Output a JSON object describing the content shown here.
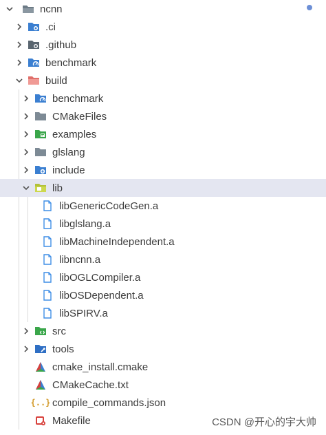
{
  "explorer": {
    "root": "ncnn",
    "items": [
      {
        "label": ".ci",
        "icon": "folder-ci-icon"
      },
      {
        "label": ".github",
        "icon": "folder-github-icon"
      },
      {
        "label": "benchmark",
        "icon": "folder-benchmark-icon"
      },
      {
        "label": "build",
        "icon": "folder-build-open-icon"
      },
      {
        "label": "benchmark",
        "icon": "folder-benchmark-icon"
      },
      {
        "label": "CMakeFiles",
        "icon": "folder-icon"
      },
      {
        "label": "examples",
        "icon": "folder-examples-icon"
      },
      {
        "label": "glslang",
        "icon": "folder-icon"
      },
      {
        "label": "include",
        "icon": "folder-include-icon"
      },
      {
        "label": "lib",
        "icon": "folder-lib-open-icon"
      },
      {
        "label": "libGenericCodeGen.a",
        "icon": "file-icon"
      },
      {
        "label": "libglslang.a",
        "icon": "file-icon"
      },
      {
        "label": "libMachineIndependent.a",
        "icon": "file-icon"
      },
      {
        "label": "libncnn.a",
        "icon": "file-icon"
      },
      {
        "label": "libOGLCompiler.a",
        "icon": "file-icon"
      },
      {
        "label": "libOSDependent.a",
        "icon": "file-icon"
      },
      {
        "label": "libSPIRV.a",
        "icon": "file-icon"
      },
      {
        "label": "src",
        "icon": "folder-src-icon"
      },
      {
        "label": "tools",
        "icon": "folder-tools-icon"
      },
      {
        "label": "cmake_install.cmake",
        "icon": "cmake-icon"
      },
      {
        "label": "CMakeCache.txt",
        "icon": "cmake-icon"
      },
      {
        "label": "compile_commands.json",
        "icon": "json-icon"
      },
      {
        "label": "Makefile",
        "icon": "makefile-icon"
      }
    ]
  },
  "watermark": "CSDN @开心的宇大帅",
  "colors": {
    "selection": "#e4e6f1",
    "folder_blue": "#3b7fd1",
    "folder_gray": "#7d8a95",
    "file_blue": "#3f8ee6",
    "cmake_red": "#d8403b",
    "json_orange": "#d39b2b"
  }
}
